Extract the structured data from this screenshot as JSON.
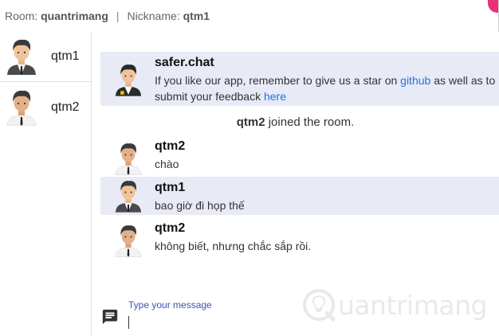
{
  "header": {
    "room_label": "Room:",
    "room_name": "quantrimang",
    "separator": "|",
    "nickname_label": "Nickname:",
    "nickname": "qtm1"
  },
  "sidebar": {
    "users": [
      {
        "name": "qtm1"
      },
      {
        "name": "qtm2"
      }
    ]
  },
  "messages": [
    {
      "author": "safer.chat",
      "text_part1": "If you like our app, remember to give us a star on ",
      "link1": "github",
      "text_part2": " as well as to",
      "text_line2": "submit your feedback ",
      "link2": "here",
      "highlighted": true
    },
    {
      "author": "qtm2",
      "text": "chào",
      "highlighted": false
    },
    {
      "author": "qtm1",
      "text": "bao giờ đi họp thế",
      "highlighted": true
    },
    {
      "author": "qtm2",
      "text": "không biết, nhưng chắc sắp rồi.",
      "highlighted": false
    }
  ],
  "system_message": {
    "user": "qtm2",
    "text": " joined the room."
  },
  "composer": {
    "label": "Type your message",
    "icon": "chat-bubble-icon"
  },
  "watermark": {
    "text": "uantrimang",
    "icon": "lightbulb-q-logo"
  },
  "colors": {
    "highlight": "#e8eaf6",
    "link": "#1a73e8",
    "accent": "#3f51b5",
    "badge": "#e8327a"
  }
}
